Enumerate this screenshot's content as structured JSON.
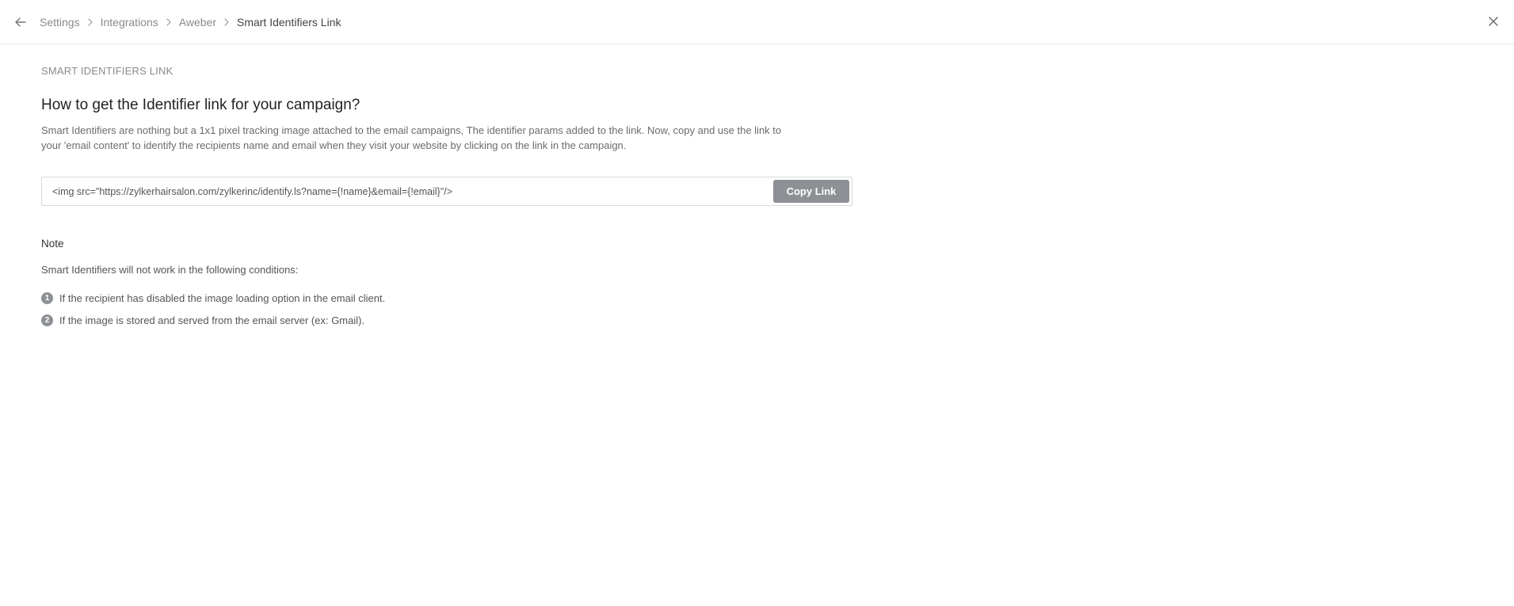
{
  "header": {
    "breadcrumb": [
      {
        "label": "Settings"
      },
      {
        "label": "Integrations"
      },
      {
        "label": "Aweber"
      },
      {
        "label": "Smart Identifiers Link"
      }
    ],
    "back_icon": "arrow-left-icon",
    "close_icon": "close-icon",
    "separator_icon": "chevron-right-icon"
  },
  "main": {
    "section_label": "SMART IDENTIFIERS LINK",
    "heading": "How to get the Identifier link for your campaign?",
    "description": "Smart Identifiers are nothing but a 1x1 pixel tracking image attached to the email campaigns, The identifier params added to the link. Now, copy and use the link to your 'email content' to identify the recipients name and email when they visit your website by clicking on the link in the campaign.",
    "link_snippet": "<img src=\"https://zylkerhairsalon.com/zylkerinc/identify.ls?name={!name}&email={!email}\"/>",
    "copy_button_label": "Copy Link"
  },
  "note": {
    "title": "Note",
    "intro": "Smart Identifiers will not work in the following conditions:",
    "conditions": [
      {
        "number": "1",
        "text": "If the recipient has disabled the image loading option in the email client."
      },
      {
        "number": "2",
        "text": "If the image is stored and served from the email server (ex: Gmail)."
      }
    ]
  },
  "colors": {
    "button_bg": "#8d9094",
    "border": "#e6e6e6",
    "muted_text": "#8a8a8a"
  }
}
